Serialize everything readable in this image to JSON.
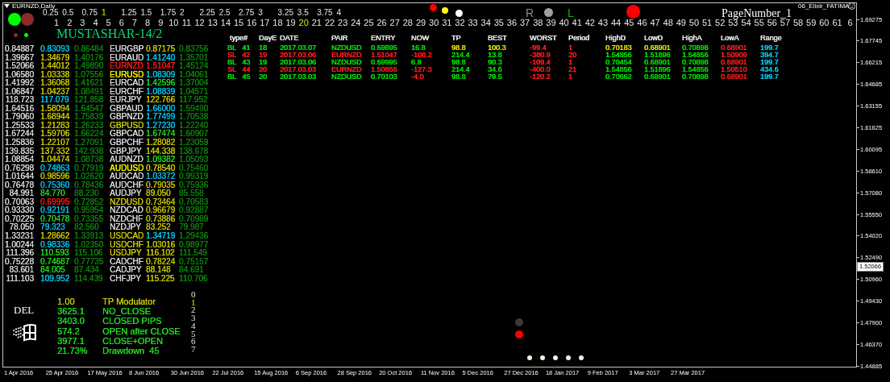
{
  "window": {
    "title": "EURNZD,Daily"
  },
  "indicator_name": "06_Elixir_FATIMA",
  "scale_labels": [
    {
      "label": "0.25",
      "selected": false
    },
    {
      "label": "0.5",
      "selected": false
    },
    {
      "label": "0.75",
      "selected": false
    },
    {
      "label": "1",
      "selected": true
    },
    {
      "label": "1.25",
      "selected": false
    },
    {
      "label": "1.5",
      "selected": false
    },
    {
      "label": "1.75",
      "selected": false
    },
    {
      "label": "2",
      "selected": false
    },
    {
      "label": "2.25",
      "selected": false
    },
    {
      "label": "2.5",
      "selected": false
    },
    {
      "label": "2.75",
      "selected": false
    },
    {
      "label": "3",
      "selected": false
    },
    {
      "label": "3.25",
      "selected": false
    },
    {
      "label": "3.5",
      "selected": false
    },
    {
      "label": "3.75",
      "selected": false
    },
    {
      "label": "4",
      "selected": false
    }
  ],
  "day_numbers": [
    {
      "label": "1",
      "selected": false
    },
    {
      "label": "2",
      "selected": false
    },
    {
      "label": "3",
      "selected": false
    },
    {
      "label": "4",
      "selected": false
    },
    {
      "label": "5",
      "selected": false
    },
    {
      "label": "6",
      "selected": false
    },
    {
      "label": "7",
      "selected": false
    },
    {
      "label": "8",
      "selected": false
    },
    {
      "label": "9",
      "selected": false
    },
    {
      "label": "10",
      "selected": false
    },
    {
      "label": "11",
      "selected": false
    },
    {
      "label": "12",
      "selected": false
    },
    {
      "label": "13",
      "selected": false
    },
    {
      "label": "14",
      "selected": false
    },
    {
      "label": "15",
      "selected": false
    },
    {
      "label": "16",
      "selected": false
    },
    {
      "label": "17",
      "selected": false
    },
    {
      "label": "18",
      "selected": false
    },
    {
      "label": "19",
      "selected": false
    },
    {
      "label": "20",
      "selected": true
    },
    {
      "label": "21",
      "selected": false
    },
    {
      "label": "22",
      "selected": false
    },
    {
      "label": "23",
      "selected": false
    },
    {
      "label": "24",
      "selected": false
    },
    {
      "label": "25",
      "selected": false
    },
    {
      "label": "26",
      "selected": false
    },
    {
      "label": "27",
      "selected": false
    },
    {
      "label": "28",
      "selected": false
    },
    {
      "label": "29",
      "selected": false
    },
    {
      "label": "30",
      "selected": false
    },
    {
      "label": "31",
      "selected": false
    },
    {
      "label": "32",
      "selected": false
    },
    {
      "label": "33",
      "selected": false
    },
    {
      "label": "34",
      "selected": false
    },
    {
      "label": "35",
      "selected": false
    },
    {
      "label": "36",
      "selected": false
    },
    {
      "label": "37",
      "selected": false
    },
    {
      "label": "38",
      "selected": false
    },
    {
      "label": "39",
      "selected": false
    },
    {
      "label": "40",
      "selected": false
    },
    {
      "label": "41",
      "selected": false
    },
    {
      "label": "42",
      "selected": false
    },
    {
      "label": "43",
      "selected": false
    },
    {
      "label": "44",
      "selected": false
    },
    {
      "label": "45",
      "selected": false
    },
    {
      "label": "46",
      "selected": false
    },
    {
      "label": "47",
      "selected": false
    },
    {
      "label": "48",
      "selected": false
    },
    {
      "label": "49",
      "selected": false
    },
    {
      "label": "50",
      "selected": false
    },
    {
      "label": "51",
      "selected": false
    },
    {
      "label": "52",
      "selected": false
    },
    {
      "label": "53",
      "selected": false
    },
    {
      "label": "54",
      "selected": false
    },
    {
      "label": "55",
      "selected": false
    },
    {
      "label": "56",
      "selected": false
    },
    {
      "label": "57",
      "selected": false
    },
    {
      "label": "58",
      "selected": false
    },
    {
      "label": "59",
      "selected": false
    },
    {
      "label": "60",
      "selected": false
    },
    {
      "label": "61",
      "selected": false
    },
    {
      "label": "6",
      "selected": false
    }
  ],
  "header_lights": [
    {
      "color": "#00ff00"
    },
    {
      "color": "#8b2a2a"
    }
  ],
  "header_small_lights": [
    {
      "color": "#8b2a2a"
    },
    {
      "color": "#00ff00"
    }
  ],
  "system_name": "MUSTASHAR-14/2",
  "top_dots": [
    {
      "color": "#ff0000"
    },
    {
      "color": "#ffff00"
    },
    {
      "color": "#ffffff"
    }
  ],
  "signals": [
    {
      "kind": "letter",
      "text": "R",
      "color": "#8c8c8c"
    },
    {
      "kind": "dot",
      "color": "#a0a0a0"
    },
    {
      "kind": "letter",
      "text": "L",
      "color": "#00c000"
    }
  ],
  "page_label": "PageNumber_1",
  "quote_table": {
    "rows": [
      {
        "column_1": "0.84887",
        "column_2": {
          "text": "0.83093",
          "color": "#00c8f0"
        },
        "column_3": "0.86484",
        "pair": {
          "text": "EURGBP",
          "color": "#dcdcdc"
        },
        "column_5": {
          "text": "0.87175",
          "color": "#cccc00"
        },
        "column_6": "0.83756"
      },
      {
        "column_1": "1.39667",
        "column_2": {
          "text": "1.34679",
          "color": "#cccc00"
        },
        "column_3": "1.40176",
        "pair": {
          "text": "EURAUD",
          "color": "#dcdcdc"
        },
        "column_5": {
          "text": "1.41240",
          "color": "#00c8f0"
        },
        "column_6": "1.35701"
      },
      {
        "column_1": "1.52066",
        "column_2": {
          "text": "1.44012",
          "color": "#cccc00"
        },
        "column_3": "1.49890",
        "pair": {
          "text": "EURNZD",
          "color": "#ff1a1a"
        },
        "column_5": {
          "text": "1.51047",
          "color": "#ff1a1a"
        },
        "column_6": "1.45124"
      },
      {
        "column_1": "1.06580",
        "column_2": {
          "text": "1.03338",
          "color": "#cccc00"
        },
        "column_3": "1.07556",
        "pair": {
          "text": "EURUSD",
          "color": "#ffff00"
        },
        "column_5": {
          "text": "1.08309",
          "color": "#00c8f0"
        },
        "column_6": "1.04061"
      },
      {
        "column_1": "1.41992",
        "column_2": {
          "text": "1.36068",
          "color": "#cccc00"
        },
        "column_3": "1.41621",
        "pair": {
          "text": "EURCAD",
          "color": "#dcdcdc"
        },
        "column_5": {
          "text": "1.42596",
          "color": "#22dd22"
        },
        "column_6": "1.37004"
      },
      {
        "column_1": "1.06847",
        "column_2": {
          "text": "1.04237",
          "color": "#cccc00"
        },
        "column_3": "1.08491",
        "pair": {
          "text": "EURCHF",
          "color": "#dcdcdc"
        },
        "column_5": {
          "text": "1.08839",
          "color": "#00c8f0"
        },
        "column_6": "1.04571"
      },
      {
        "column_1": "118.723",
        "column_2": {
          "text": "117.079",
          "color": "#00c8f0"
        },
        "column_3": "121.858",
        "pair": {
          "text": "EURJPY",
          "color": "#dcdcdc"
        },
        "column_5": {
          "text": "122.766",
          "color": "#cccc00"
        },
        "column_6": "117.952"
      },
      {
        "column_1": "1.64516",
        "column_2": {
          "text": "1.58094",
          "color": "#cccc00"
        },
        "column_3": "1.64547",
        "pair": {
          "text": "GBPAUD",
          "color": "#dcdcdc"
        },
        "column_5": {
          "text": "1.66000",
          "color": "#00c8f0"
        },
        "column_6": "1.59490"
      },
      {
        "column_1": "1.79060",
        "column_2": {
          "text": "1.68944",
          "color": "#cccc00"
        },
        "column_3": "1.75839",
        "pair": {
          "text": "GBPNZD",
          "color": "#dcdcdc"
        },
        "column_5": {
          "text": "1.77499",
          "color": "#00c8f0"
        },
        "column_6": "1.70538"
      },
      {
        "column_1": "1.25533",
        "column_2": {
          "text": "1.21283",
          "color": "#cccc00"
        },
        "column_3": "1.26233",
        "pair": {
          "text": "GBPUSD",
          "color": "#cccc00"
        },
        "column_5": {
          "text": "1.27230",
          "color": "#00c8f0"
        },
        "column_6": "1.22240"
      },
      {
        "column_1": "1.67244",
        "column_2": {
          "text": "1.59706",
          "color": "#cccc00"
        },
        "column_3": "1.66224",
        "pair": {
          "text": "GBPCAD",
          "color": "#dcdcdc"
        },
        "column_5": {
          "text": "1.67474",
          "color": "#22dd22"
        },
        "column_6": "1.60907"
      },
      {
        "column_1": "1.25836",
        "column_2": {
          "text": "1.22107",
          "color": "#cccc00"
        },
        "column_3": "1.27091",
        "pair": {
          "text": "GBPCHF",
          "color": "#dcdcdc"
        },
        "column_5": {
          "text": "1.28082",
          "color": "#cccc00"
        },
        "column_6": "1.23059"
      },
      {
        "column_1": "139.835",
        "column_2": {
          "text": "137.332",
          "color": "#cccc00"
        },
        "column_3": "142.938",
        "pair": {
          "text": "GBPJPY",
          "color": "#dcdcdc"
        },
        "column_5": {
          "text": "144.338",
          "color": "#cccc00"
        },
        "column_6": "138.678"
      },
      {
        "column_1": "1.08854",
        "column_2": {
          "text": "1.04474",
          "color": "#cccc00"
        },
        "column_3": "1.08738",
        "pair": {
          "text": "AUDNZD",
          "color": "#dcdcdc"
        },
        "column_5": {
          "text": "1.09382",
          "color": "#22dd22"
        },
        "column_6": "1.05093"
      },
      {
        "column_1": "0.76298",
        "column_2": {
          "text": "0.74863",
          "color": "#00c8f0"
        },
        "column_3": "0.77919",
        "pair": {
          "text": "AUDUSD",
          "color": "#ffff00"
        },
        "column_5": {
          "text": "0.78540",
          "color": "#cccc00"
        },
        "column_6": "0.75460"
      },
      {
        "column_1": "1.01644",
        "column_2": {
          "text": "0.98596",
          "color": "#cccc00"
        },
        "column_3": "1.02620",
        "pair": {
          "text": "AUDCAD",
          "color": "#dcdcdc"
        },
        "column_5": {
          "text": "1.03372",
          "color": "#00c8f0"
        },
        "column_6": "0.99319"
      },
      {
        "column_1": "0.76478",
        "column_2": {
          "text": "0.75360",
          "color": "#00c8f0"
        },
        "column_3": "0.78436",
        "pair": {
          "text": "AUDCHF",
          "color": "#dcdcdc"
        },
        "column_5": {
          "text": "0.79035",
          "color": "#cccc00"
        },
        "column_6": "0.75936"
      },
      {
        "column_1": "84.991",
        "column_2": {
          "text": "84.770",
          "color": "#22dd22"
        },
        "column_3": "88.230",
        "pair": {
          "text": "AUDJPY",
          "color": "#dcdcdc"
        },
        "column_5": {
          "text": "89.050",
          "color": "#cccc00"
        },
        "column_6": "85.558"
      },
      {
        "column_1": "0.70063",
        "column_2": {
          "text": "0.69995",
          "color": "#ff1a1a"
        },
        "column_3": "0.72852",
        "pair": {
          "text": "NZDUSD",
          "color": "#cccc00"
        },
        "column_5": {
          "text": "0.73464",
          "color": "#cccc00"
        },
        "column_6": "0.70583"
      },
      {
        "column_1": "0.93330",
        "column_2": {
          "text": "0.92191",
          "color": "#00c8f0"
        },
        "column_3": "0.95954",
        "pair": {
          "text": "NZDCAD",
          "color": "#dcdcdc"
        },
        "column_5": {
          "text": "0.96679",
          "color": "#cccc00"
        },
        "column_6": "0.92887"
      },
      {
        "column_1": "0.70225",
        "column_2": {
          "text": "0.70478",
          "color": "#22dd22"
        },
        "column_3": "0.73355",
        "pair": {
          "text": "NZDCHF",
          "color": "#dcdcdc"
        },
        "column_5": {
          "text": "0.73886",
          "color": "#cccc00"
        },
        "column_6": "0.70989"
      },
      {
        "column_1": "78.050",
        "column_2": {
          "text": "79.323",
          "color": "#00c8f0"
        },
        "column_3": "82.560",
        "pair": {
          "text": "NZDJPY",
          "color": "#dcdcdc"
        },
        "column_5": {
          "text": "83.252",
          "color": "#cccc00"
        },
        "column_6": "79.987"
      },
      {
        "column_1": "1.33231",
        "column_2": {
          "text": "1.28662",
          "color": "#cccc00"
        },
        "column_3": "1.33913",
        "pair": {
          "text": "USDCAD",
          "color": "#cccc00"
        },
        "column_5": {
          "text": "1.34719",
          "color": "#00c8f0"
        },
        "column_6": "1.29436"
      },
      {
        "column_1": "1.00244",
        "column_2": {
          "text": "0.98336",
          "color": "#00c8f0"
        },
        "column_3": "1.02350",
        "pair": {
          "text": "USDCHF",
          "color": "#cccc00"
        },
        "column_5": {
          "text": "1.03016",
          "color": "#cccc00"
        },
        "column_6": "0.98977"
      },
      {
        "column_1": "111.396",
        "column_2": {
          "text": "110.593",
          "color": "#22dd22"
        },
        "column_3": "115.106",
        "pair": {
          "text": "USDJPY",
          "color": "#cccc00"
        },
        "column_5": {
          "text": "116.102",
          "color": "#cccc00"
        },
        "column_6": "111.549"
      },
      {
        "column_1": "0.75228",
        "column_2": {
          "text": "0.74687",
          "color": "#22dd22"
        },
        "column_3": "0.77735",
        "pair": {
          "text": "CADCHF",
          "color": "#dcdcdc"
        },
        "column_5": {
          "text": "0.78224",
          "color": "#cccc00"
        },
        "column_6": "0.75157"
      },
      {
        "column_1": "83.601",
        "column_2": {
          "text": "84.005",
          "color": "#22dd22"
        },
        "column_3": "87.434",
        "pair": {
          "text": "CADJPY",
          "color": "#dcdcdc"
        },
        "column_5": {
          "text": "88.148",
          "color": "#cccc00"
        },
        "column_6": "84.691"
      },
      {
        "column_1": "111.103",
        "column_2": {
          "text": "109.952",
          "color": "#00c8f0"
        },
        "column_3": "114.439",
        "pair": {
          "text": "CHFJPY",
          "color": "#dcdcdc"
        },
        "column_5": {
          "text": "115.225",
          "color": "#cccc00"
        },
        "column_6": "110.706"
      }
    ]
  },
  "trades": {
    "columns": [
      "type#",
      "DayE",
      "DATE",
      "PAIR",
      "ENTRY",
      "NOW",
      "TP",
      "BEST",
      "WORST",
      "Period",
      "HighD",
      "LowD",
      "HighA",
      "LowA",
      "Range"
    ],
    "rows": [
      {
        "cells": [
          {
            "text": "BL   41",
            "color": "#00dd00"
          },
          {
            "text": "18",
            "color": "#00dd00"
          },
          {
            "text": "2017.03.07",
            "color": "#00dd00"
          },
          {
            "text": "NZDUSD",
            "color": "#00dd00"
          },
          {
            "text": "0.69895",
            "color": "#00dd00"
          },
          {
            "text": "16.8",
            "color": "#00dd00"
          },
          {
            "text": "98.8",
            "color": "#dddd00"
          },
          {
            "text": "100.3",
            "color": "#dddd00"
          },
          {
            "text": "-99.4",
            "color": "#ff1a1a"
          },
          {
            "text": "1",
            "color": "#ff1a1a"
          },
          {
            "text": "0.70183",
            "color": "#dddd00"
          },
          {
            "text": "0.68901",
            "color": "#dddd00"
          },
          {
            "text": "0.70898",
            "color": "#00dd00"
          },
          {
            "text": "0.68901",
            "color": "#ff1a1a"
          },
          {
            "text": "199.7",
            "color": "#00c8f0"
          }
        ]
      },
      {
        "cells": [
          {
            "text": "SL   42",
            "color": "#ff1a1a"
          },
          {
            "text": "19",
            "color": "#ff1a1a"
          },
          {
            "text": "2017.03.06",
            "color": "#ff1a1a"
          },
          {
            "text": "EURNZD",
            "color": "#ff1a1a"
          },
          {
            "text": "1.51047",
            "color": "#ff1a1a"
          },
          {
            "text": "-108.2",
            "color": "#ff1a1a"
          },
          {
            "text": "214.4",
            "color": "#00dd00"
          },
          {
            "text": "13.8",
            "color": "#00dd00"
          },
          {
            "text": "-380.9",
            "color": "#ff1a1a"
          },
          {
            "text": "20",
            "color": "#ff1a1a"
          },
          {
            "text": "1.54856",
            "color": "#00dd00"
          },
          {
            "text": "1.51896",
            "color": "#00dd00"
          },
          {
            "text": "1.54856",
            "color": "#00dd00"
          },
          {
            "text": "1.50909",
            "color": "#ff1a1a"
          },
          {
            "text": "394.7",
            "color": "#00c8f0"
          }
        ]
      },
      {
        "cells": [
          {
            "text": "BL   43",
            "color": "#00dd00"
          },
          {
            "text": "19",
            "color": "#00dd00"
          },
          {
            "text": "2017.03.06",
            "color": "#00dd00"
          },
          {
            "text": "NZDUSD",
            "color": "#00dd00"
          },
          {
            "text": "0.69995",
            "color": "#00dd00"
          },
          {
            "text": "6.8",
            "color": "#00dd00"
          },
          {
            "text": "98.8",
            "color": "#00dd00"
          },
          {
            "text": "90.3",
            "color": "#00dd00"
          },
          {
            "text": "-109.4",
            "color": "#ff1a1a"
          },
          {
            "text": "1",
            "color": "#ff1a1a"
          },
          {
            "text": "0.70454",
            "color": "#00dd00"
          },
          {
            "text": "0.68901",
            "color": "#00dd00"
          },
          {
            "text": "0.70898",
            "color": "#00dd00"
          },
          {
            "text": "0.68901",
            "color": "#ff1a1a"
          },
          {
            "text": "199.7",
            "color": "#00c8f0"
          }
        ]
      },
      {
        "cells": [
          {
            "text": "SL   44",
            "color": "#ff1a1a"
          },
          {
            "text": "20",
            "color": "#ff1a1a"
          },
          {
            "text": "2017.03.03",
            "color": "#ff1a1a"
          },
          {
            "text": "EURNZD",
            "color": "#ff1a1a"
          },
          {
            "text": "1.50856",
            "color": "#ff1a1a"
          },
          {
            "text": "-127.3",
            "color": "#ff1a1a"
          },
          {
            "text": "214.4",
            "color": "#00dd00"
          },
          {
            "text": "34.6",
            "color": "#00dd00"
          },
          {
            "text": "-400.0",
            "color": "#ff1a1a"
          },
          {
            "text": "21",
            "color": "#ff1a1a"
          },
          {
            "text": "1.54856",
            "color": "#00dd00"
          },
          {
            "text": "1.51896",
            "color": "#00dd00"
          },
          {
            "text": "1.54856",
            "color": "#00dd00"
          },
          {
            "text": "1.50510",
            "color": "#ff1a1a"
          },
          {
            "text": "434.6",
            "color": "#00c8f0"
          }
        ]
      },
      {
        "cells": [
          {
            "text": "BL   45",
            "color": "#00dd00"
          },
          {
            "text": "20",
            "color": "#00dd00"
          },
          {
            "text": "2017.03.03",
            "color": "#00dd00"
          },
          {
            "text": "NZDUSD",
            "color": "#00dd00"
          },
          {
            "text": "0.70103",
            "color": "#00dd00"
          },
          {
            "text": "-4.0",
            "color": "#ff1a1a"
          },
          {
            "text": "98.8",
            "color": "#00dd00"
          },
          {
            "text": "79.5",
            "color": "#00dd00"
          },
          {
            "text": "-120.2",
            "color": "#ff1a1a"
          },
          {
            "text": "1",
            "color": "#ff1a1a"
          },
          {
            "text": "0.70662",
            "color": "#00dd00"
          },
          {
            "text": "0.68901",
            "color": "#00dd00"
          },
          {
            "text": "0.70898",
            "color": "#00dd00"
          },
          {
            "text": "0.68901",
            "color": "#ff1a1a"
          },
          {
            "text": "199.7",
            "color": "#00c8f0"
          }
        ]
      }
    ]
  },
  "summary": {
    "del_label": "DEL",
    "items": [
      {
        "value": "1.00",
        "label": "TP Modulator",
        "color": "#cccc00"
      },
      {
        "value": "3625.1",
        "label": "NO_CLOSE",
        "color": "#22dd22"
      },
      {
        "value": "3403.0",
        "label": "CLOSED PIPS",
        "color": "#22dd22"
      },
      {
        "value": "574.2",
        "label": "OPEN after CLOSE",
        "color": "#22dd22"
      },
      {
        "value": "3977.1",
        "label": "CLOSE+OPEN",
        "color": "#22dd22"
      },
      {
        "value": "21.73%",
        "label": "Drawdown  45",
        "color": "#22dd22"
      }
    ]
  },
  "index_digits": [
    {
      "label": "0",
      "selected": false
    },
    {
      "label": "1",
      "selected": true
    },
    {
      "label": "2",
      "selected": false
    },
    {
      "label": "3",
      "selected": false
    },
    {
      "label": "4",
      "selected": false
    },
    {
      "label": "5",
      "selected": false
    },
    {
      "label": "6",
      "selected": false
    },
    {
      "label": "7",
      "selected": false
    }
  ],
  "markers": [
    {
      "color": "#3a3a3a"
    },
    {
      "color": "#ff0000"
    }
  ],
  "time_axis": {
    "labels": [
      "1 Apr 2016",
      "25 Apr 2016",
      "17 May 2016",
      "8 Jun 2016",
      "30 Jun 2016",
      "22 Jul 2016",
      "15 Aug 2016",
      "6 Sep 2016",
      "28 Sep 2016",
      "20 Oct 2016",
      "11 Nov 2016",
      "5 Dec 2016",
      "27 Dec 2016",
      "18 Jan 2017",
      "9 Feb 2017",
      "3 Mar 2017",
      "27 Mar 2017"
    ]
  },
  "price_axis": {
    "ticks": [
      "1.69275",
      "1.67745",
      "1.66215",
      "1.64685",
      "1.63155",
      "1.61625",
      "1.60095",
      "1.58610",
      "1.57080",
      "1.55550",
      "1.54020",
      "1.52490",
      "1.50960",
      "1.49430",
      "1.47900",
      "1.46370",
      "1.44885"
    ],
    "current_price": "1.52066"
  }
}
